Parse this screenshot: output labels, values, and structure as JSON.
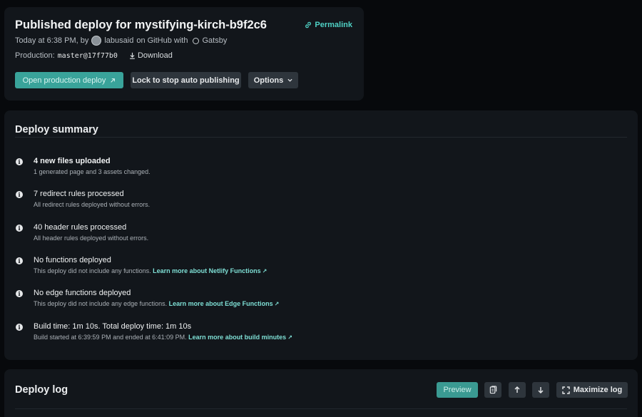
{
  "header": {
    "title": "Published deploy for mystifying-kirch-b9f2c6",
    "permalink": "Permalink",
    "meta_prefix": "Today at 6:38 PM, by",
    "author": "labusaid",
    "meta_on": "on GitHub  with",
    "framework": "Gatsby",
    "production_label": "Production:",
    "commit_ref": "master@17f77b0",
    "download_label": "Download",
    "open_button": "Open production deploy",
    "lock_button": "Lock to stop auto publishing",
    "options_button": "Options"
  },
  "summary": {
    "title": "Deploy summary",
    "items": [
      {
        "title": "4 new files uploaded",
        "sub": "1 generated page and 3 assets changed.",
        "link": ""
      },
      {
        "title": "7 redirect rules processed",
        "sub": "All redirect rules deployed without errors.",
        "link": ""
      },
      {
        "title": "40 header rules processed",
        "sub": "All header rules deployed without errors.",
        "link": ""
      },
      {
        "title": "No functions deployed",
        "sub": "This deploy did not include any functions.",
        "link": "Learn more about Netlify Functions"
      },
      {
        "title": "No edge functions deployed",
        "sub": "This deploy did not include any edge functions.",
        "link": "Learn more about Edge Functions"
      },
      {
        "title": "Build time: 1m 10s. Total deploy time: 1m 10s",
        "sub": "Build started at 6:39:59 PM and ended at 6:41:09 PM.",
        "link": "Learn more about build minutes"
      }
    ]
  },
  "log": {
    "title": "Deploy log",
    "preview_button": "Preview",
    "maximize_button": "Maximize log"
  },
  "colors": {
    "accent": "#39a39a",
    "link": "#4fd1c5",
    "background": "#07090c",
    "card": "#12161b"
  },
  "icons": [
    "link-icon",
    "avatar",
    "gatsby-icon",
    "download-icon",
    "external-link-icon",
    "chevron-down-icon",
    "info-icon",
    "copy-icon",
    "arrow-up-icon",
    "arrow-down-icon",
    "maximize-icon"
  ]
}
